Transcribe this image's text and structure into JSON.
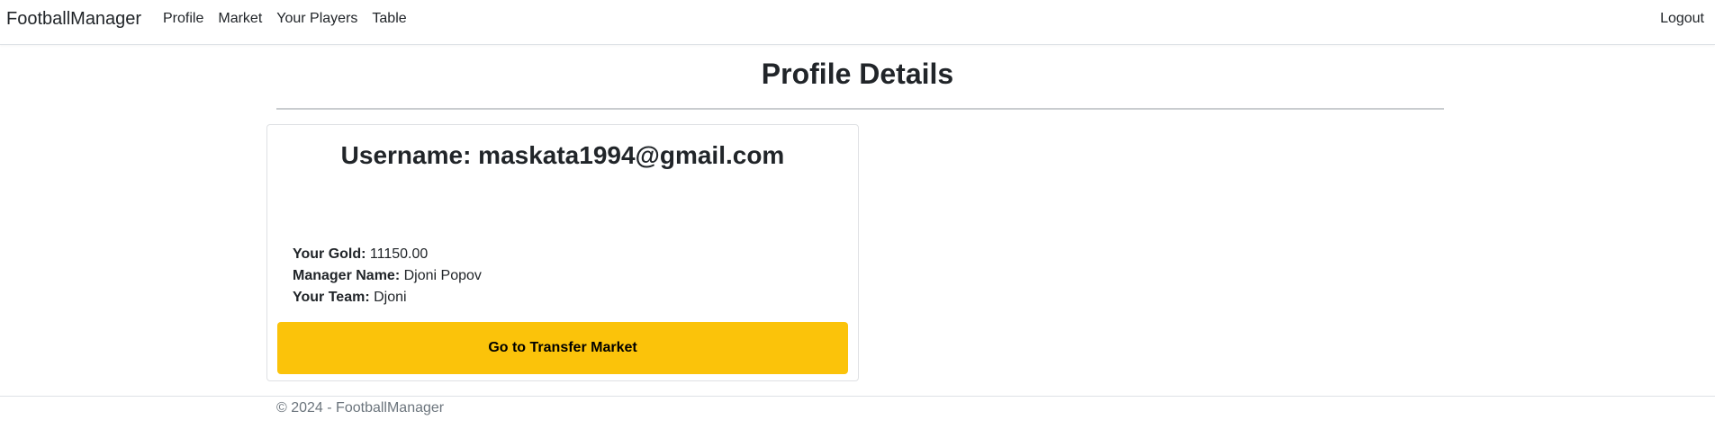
{
  "navbar": {
    "brand": "FootballManager",
    "links": [
      "Profile",
      "Market",
      "Your Players",
      "Table"
    ],
    "logout": "Logout"
  },
  "page": {
    "title": "Profile Details"
  },
  "card": {
    "username": "Username: maskata1994@gmail.com",
    "fields": [
      {
        "label": "Your Gold:",
        "value": "11150.00"
      },
      {
        "label": "Manager Name:",
        "value": "Djoni Popov"
      },
      {
        "label": "Your Team:",
        "value": "Djoni"
      }
    ],
    "button_label": "Go to Transfer Market",
    "button_color": "#fbc30a"
  },
  "footer": {
    "text": "© 2024 - FootballManager"
  }
}
